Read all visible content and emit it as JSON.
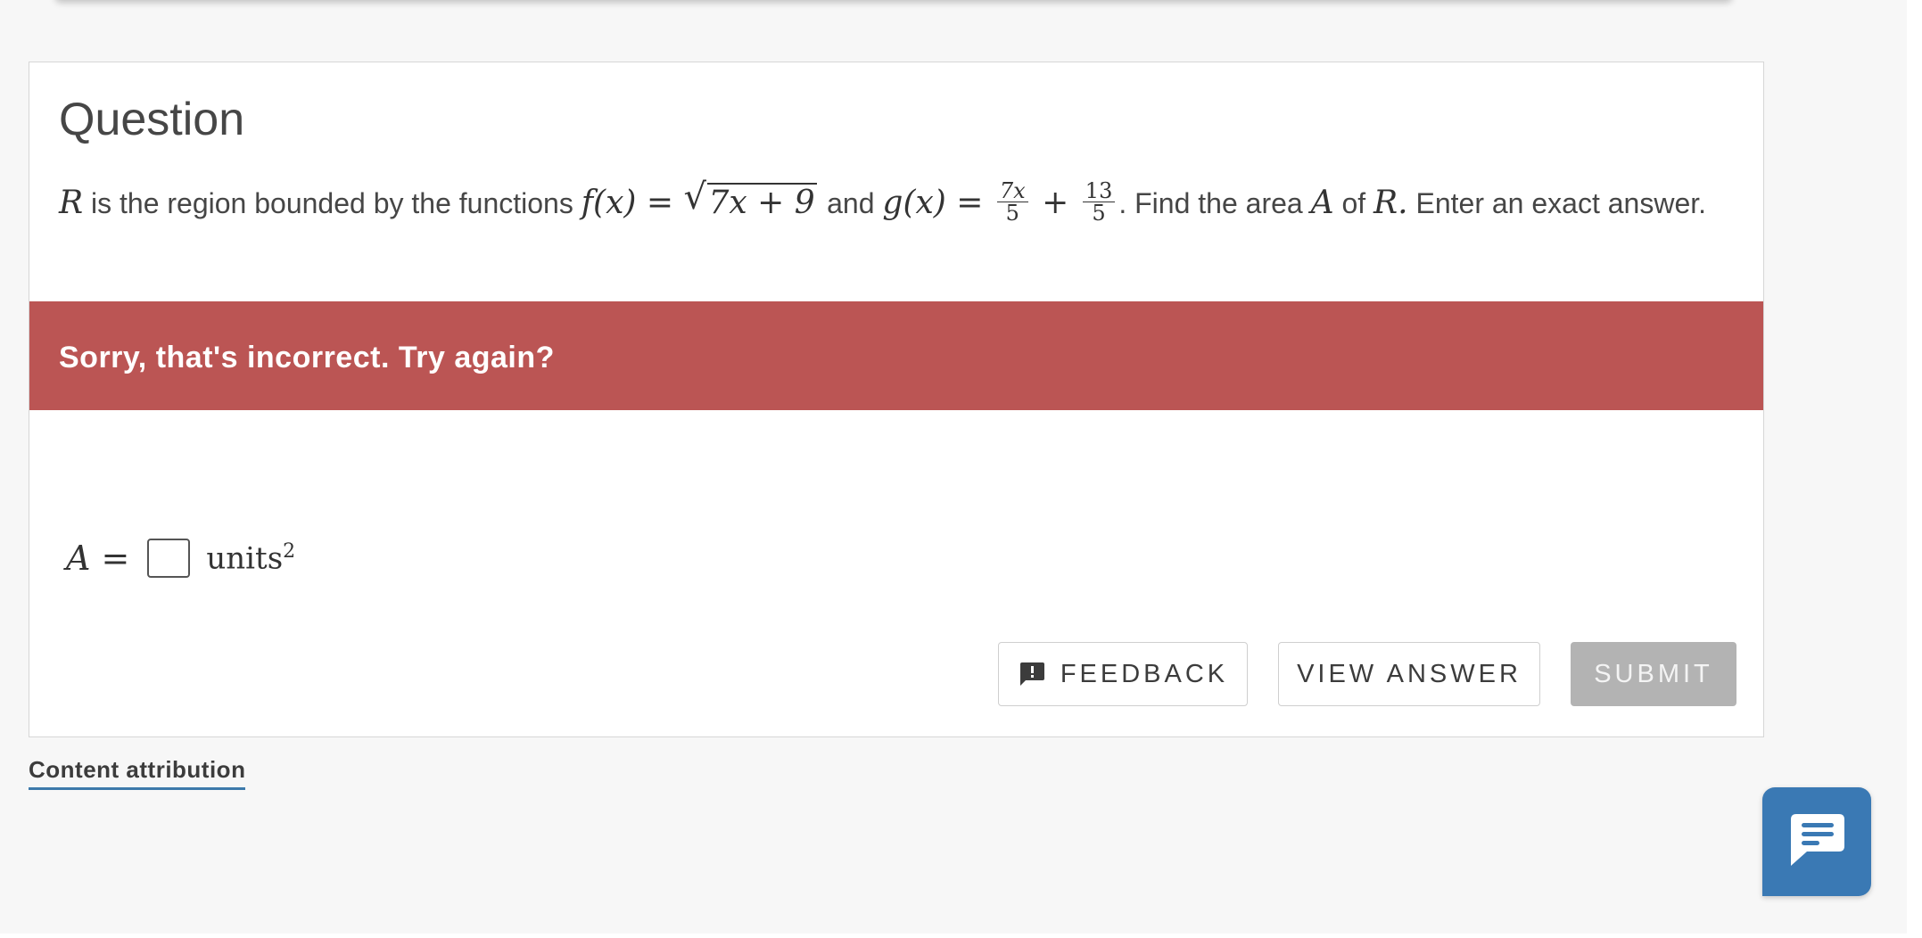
{
  "question": {
    "title": "Question",
    "intro_var": "R",
    "text_1": "is the region bounded by the functions",
    "f_label": "f(x) =",
    "f_radicand": "7x + 9",
    "text_and": "and",
    "g_label": "g(x) =",
    "g_frac1_num": "7x",
    "g_frac1_den": "5",
    "g_plus": "+",
    "g_frac2_num": "13",
    "g_frac2_den": "5",
    "text_2": ". Find the area",
    "area_var": "A",
    "text_of": "of",
    "region_var": "R.",
    "text_3": "Enter an exact answer."
  },
  "banner": {
    "text": "Sorry, that's incorrect. Try again?",
    "color": "#bb5554"
  },
  "answer": {
    "label": "A =",
    "value": "",
    "units": "units",
    "units_exp": "2"
  },
  "buttons": {
    "feedback": "FEEDBACK",
    "feedback_icon": "feedback-exclamation-icon",
    "view_answer": "VIEW ANSWER",
    "submit": "SUBMIT"
  },
  "footer": {
    "attribution": "Content attribution"
  },
  "chat": {
    "icon": "chat-bubble-icon",
    "color": "#3a79b4"
  }
}
